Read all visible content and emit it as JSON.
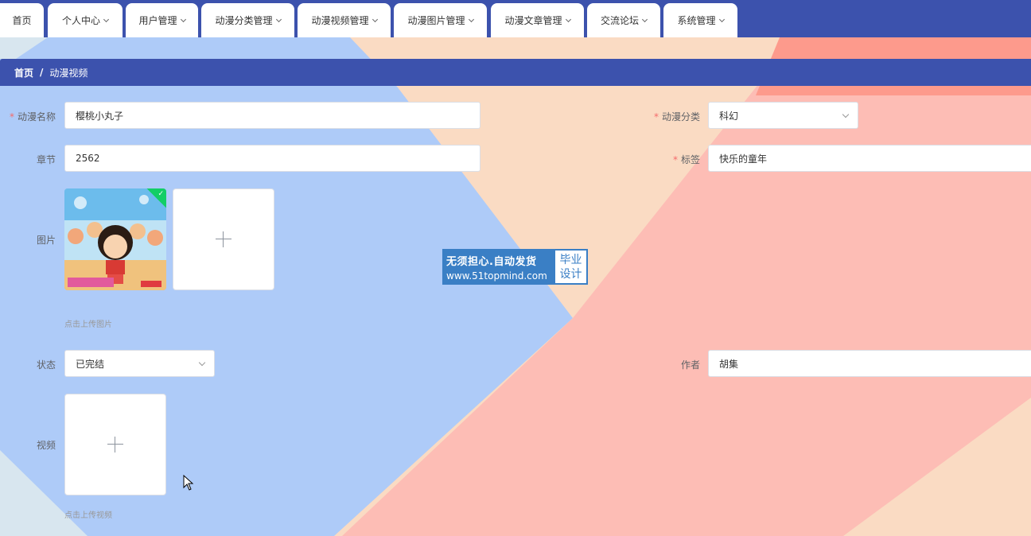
{
  "nav": {
    "tabs": [
      {
        "label": "首页",
        "dropdown": false
      },
      {
        "label": "个人中心",
        "dropdown": true
      },
      {
        "label": "用户管理",
        "dropdown": true
      },
      {
        "label": "动漫分类管理",
        "dropdown": true
      },
      {
        "label": "动漫视频管理",
        "dropdown": true
      },
      {
        "label": "动漫图片管理",
        "dropdown": true
      },
      {
        "label": "动漫文章管理",
        "dropdown": true
      },
      {
        "label": "交流论坛",
        "dropdown": true
      },
      {
        "label": "系统管理",
        "dropdown": true
      }
    ]
  },
  "breadcrumb": {
    "home": "首页",
    "separator": "/",
    "current": "动漫视频"
  },
  "form": {
    "name": {
      "label": "动漫名称",
      "required": "*",
      "value": "樱桃小丸子"
    },
    "category": {
      "label": "动漫分类",
      "required": "*",
      "value": "科幻"
    },
    "chapter": {
      "label": "章节",
      "value": "2562"
    },
    "tags": {
      "label": "标签",
      "required": "*",
      "value": "快乐的童年"
    },
    "image": {
      "label": "图片",
      "hint": "点击上传图片"
    },
    "status": {
      "label": "状态",
      "value": "已完结"
    },
    "author": {
      "label": "作者",
      "value": "胡集"
    },
    "video": {
      "label": "视频",
      "hint": "点击上传视频"
    }
  },
  "watermark": {
    "line1": "无须担心.自动发货",
    "line2": "www.51topmind.com",
    "tag1": "毕业",
    "tag2": "设计"
  },
  "colors": {
    "primary": "#3c52ad",
    "upload_success": "#13ce66",
    "required": "#f56c6c"
  }
}
